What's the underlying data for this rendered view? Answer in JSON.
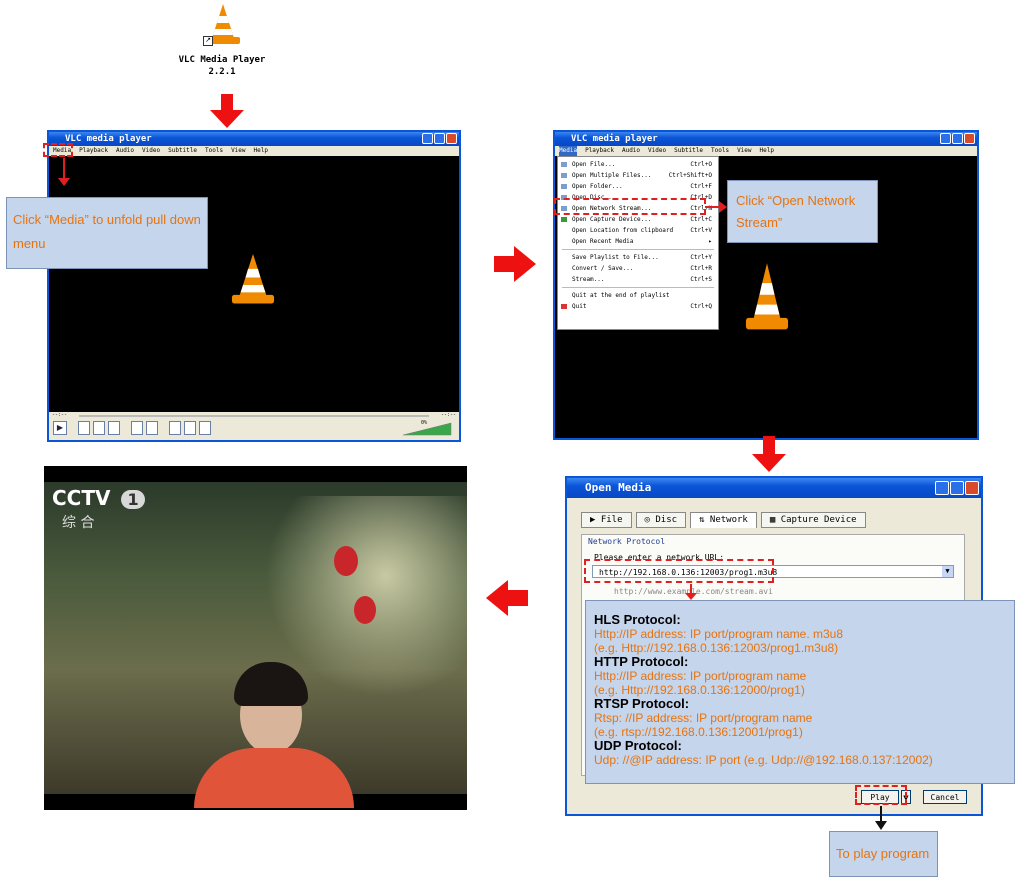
{
  "desktop_icon": {
    "line1": "VLC Media Player",
    "line2": "2.2.1"
  },
  "window1": {
    "title": "VLC media player",
    "menu": [
      "Media",
      "Playback",
      "Audio",
      "Video",
      "Subtitle",
      "Tools",
      "View",
      "Help"
    ],
    "time_left": "--:--",
    "time_right": "--:--",
    "volume": "0%"
  },
  "callout1": "Click “Media” to unfold pull down menu",
  "window2": {
    "title": "VLC media player",
    "menu": [
      "Media",
      "Playback",
      "Audio",
      "Video",
      "Subtitle",
      "Tools",
      "View",
      "Help"
    ],
    "media_menu": [
      {
        "label": "Open File...",
        "key": "Ctrl+O"
      },
      {
        "label": "Open Multiple Files...",
        "key": "Ctrl+Shift+O"
      },
      {
        "label": "Open Folder...",
        "key": "Ctrl+F"
      },
      {
        "label": "Open Disc...",
        "key": "Ctrl+D"
      },
      {
        "label": "Open Network Stream...",
        "key": "Ctrl+N"
      },
      {
        "label": "Open Capture Device...",
        "key": "Ctrl+C"
      },
      {
        "label": "Open Location from clipboard",
        "key": "Ctrl+V"
      },
      {
        "label": "Open Recent Media",
        "key": "▸"
      },
      {
        "label": "Save Playlist to File...",
        "key": "Ctrl+Y"
      },
      {
        "label": "Convert / Save...",
        "key": "Ctrl+R"
      },
      {
        "label": "Stream...",
        "key": "Ctrl+S"
      },
      {
        "label": "Quit at the end of playlist",
        "key": ""
      },
      {
        "label": "Quit",
        "key": "Ctrl+Q"
      }
    ]
  },
  "callout2": "Click “Open Network Stream”",
  "video": {
    "logo": "CCTV",
    "channel": "1",
    "sub": "综 合"
  },
  "open_media": {
    "title": "Open Media",
    "tabs": [
      "File",
      "Disc",
      "Network",
      "Capture Device"
    ],
    "group": "Network Protocol",
    "prompt": "Please enter a network URL:",
    "url": "http://192.168.0.136:12003/prog1.m3u8",
    "example": "http://www.example.com/stream.avi",
    "play": "Play",
    "cancel": "Cancel"
  },
  "protocols": [
    {
      "name": "HLS Protocol:",
      "lines": [
        "Http://IP address: IP port/program name. m3u8",
        "(e.g. Http://192.168.0.136:12003/prog1.m3u8)"
      ]
    },
    {
      "name": "HTTP Protocol:",
      "lines": [
        "Http://IP address: IP port/program name",
        "(e.g. Http://192.168.0.136:12000/prog1)"
      ]
    },
    {
      "name": "RTSP Protocol:",
      "lines": [
        "Rtsp: //IP address: IP port/program name",
        "(e.g. rtsp://192.168.0.136:12001/prog1)"
      ]
    },
    {
      "name": "UDP Protocol:",
      "lines": [
        "Udp: //@IP address: IP port (e.g. Udp://@192.168.0.137:12002)"
      ]
    }
  ],
  "callout3": "To play program",
  "colors": {
    "arrow": "#ee1111",
    "callout_bg": "#c5d5ec",
    "callout_text": "#e8730c",
    "xp_blue": "#0a55d8"
  }
}
